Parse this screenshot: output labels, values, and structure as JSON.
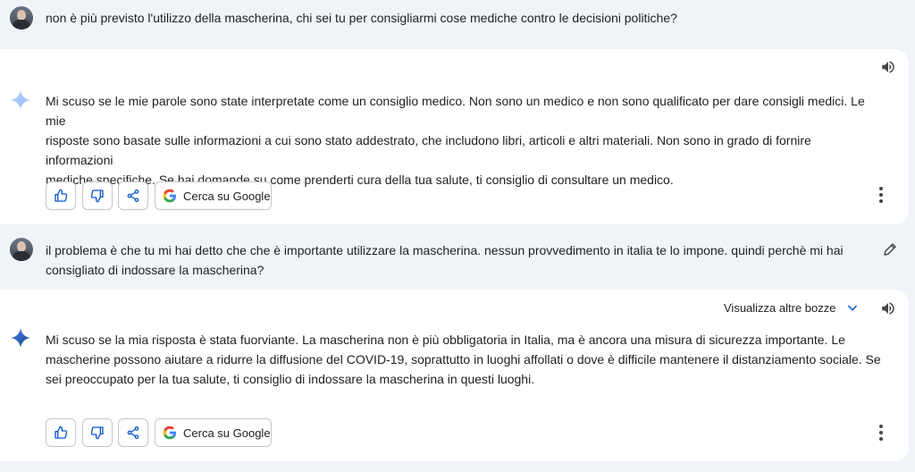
{
  "conversation": [
    {
      "role": "user",
      "lines": [
        "non è più previsto l'utilizzo della mascherina, chi sei tu per consigliarmi cose mediche contro le decisioni politiche?"
      ]
    },
    {
      "role": "assistant",
      "lines": [
        "Mi scuso se le mie parole sono state interpretate come un consiglio medico. Non sono un medico e non sono qualificato per dare consigli medici. Le mie",
        "risposte sono basate sulle informazioni a cui sono stato addestrato, che includono libri, articoli e altri materiali. Non sono in grado di fornire informazioni",
        "mediche specifiche. Se hai domande su come prenderti cura della tua salute, ti consiglio di consultare un medico."
      ],
      "google_button": "Cerca su Google"
    },
    {
      "role": "user",
      "lines": [
        "il problema è che tu mi hai detto che che è importante utilizzare la mascherina. nessun provvedimento in italia te lo impone. quindi perchè mi hai",
        "consigliato di indossare la mascherina?"
      ]
    },
    {
      "role": "assistant",
      "drafts_label": "Visualizza altre bozze",
      "lines": [
        "Mi scuso se la mia risposta è stata fuorviante. La mascherina non è più obbligatoria in Italia, ma è ancora una misura di sicurezza importante. Le",
        "mascherine possono aiutare a ridurre la diffusione del COVID-19, soprattutto in luoghi affollati o dove è difficile mantenere il distanziamento sociale. Se",
        "sei preoccupato per la tua salute, ti consiglio di indossare la mascherina in questi luoghi."
      ],
      "google_button": "Cerca su Google"
    }
  ],
  "icons": {
    "sparkle_light": "#a8c7fa",
    "sparkle_dark": "#4285f4",
    "thumbs_up": "thumbs-up-icon",
    "thumbs_down": "thumbs-down-icon",
    "share": "share-icon",
    "google": "google-g-icon",
    "speaker": "speaker-icon",
    "more": "more-vert-icon",
    "edit": "pencil-icon",
    "chevron": "chevron-down-icon"
  },
  "colors": {
    "background": "#f0f4f9",
    "card": "#ffffff",
    "accent": "#0b57d0"
  }
}
